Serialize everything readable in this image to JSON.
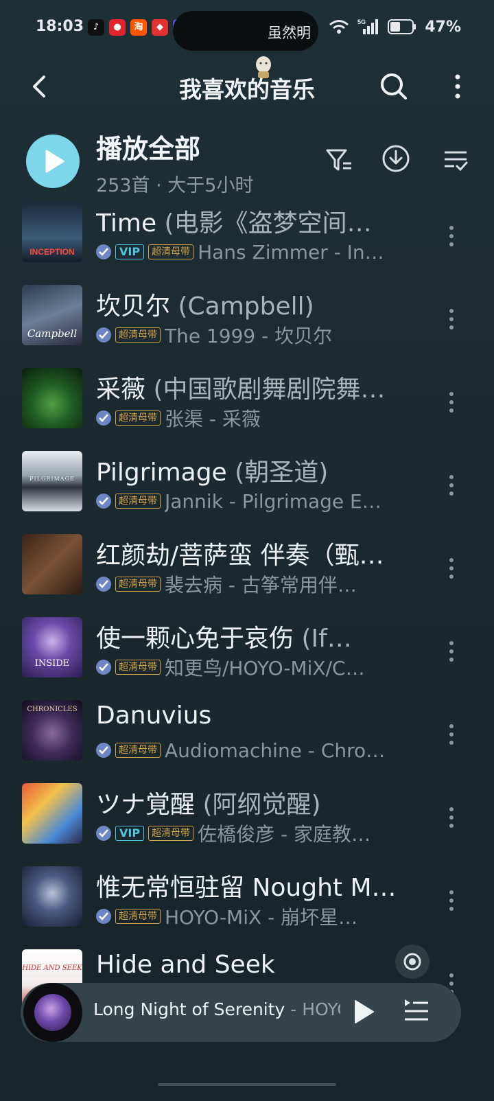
{
  "status_bar": {
    "time": "18:03",
    "pill_text": "虽然明",
    "battery": "47%",
    "network": "5G"
  },
  "header": {
    "title": "我喜欢的音乐"
  },
  "play_all": {
    "label": "播放全部",
    "meta": "253首 · 大于5小时"
  },
  "songs": [
    {
      "title": "Time",
      "subtitle": " (电影《盗梦空间…",
      "vip": true,
      "quality": "超清母带",
      "artist": "Hans Zimmer - In…",
      "cover_text": "INCEPTION"
    },
    {
      "title": "坎贝尔",
      "subtitle": " (Campbell)",
      "vip": false,
      "quality": "超清母带",
      "artist": "The 1999 - 坎贝尔",
      "cover_text": "Campbell"
    },
    {
      "title": "采薇",
      "subtitle": " (中国歌剧舞剧院舞…",
      "vip": false,
      "quality": "超清母带",
      "artist": "张渠 - 采薇",
      "cover_text": ""
    },
    {
      "title": "Pilgrimage",
      "subtitle": " (朝圣道)",
      "vip": false,
      "quality": "超清母带",
      "artist": "Jannik - Pilgrimage E…",
      "cover_text": "PILGRIMAGE"
    },
    {
      "title": "红颜劫/菩萨蛮 伴奏（甄…",
      "subtitle": "",
      "vip": false,
      "quality": "超清母带",
      "artist": "裴去病 - 古筝常用伴…",
      "cover_text": ""
    },
    {
      "title": "使一颗心免于哀伤",
      "subtitle": " (If…",
      "vip": false,
      "quality": "超清母带",
      "artist": "知更鸟/HOYO-MiX/C…",
      "cover_text": "INSIDE"
    },
    {
      "title": "Danuvius",
      "subtitle": "",
      "vip": false,
      "quality": "超清母带",
      "artist": "Audiomachine - Chro…",
      "cover_text": "CHRONICLES"
    },
    {
      "title": "ツナ覚醒",
      "subtitle": " (阿纲觉醒)",
      "vip": true,
      "quality": "超清母带",
      "artist": "佐橋俊彦 - 家庭教…",
      "cover_text": ""
    },
    {
      "title": "惟无常恒驻留 Nought M…",
      "subtitle": "",
      "vip": false,
      "quality": "超清母带",
      "artist": "HOYO-MiX - 崩坏星…",
      "cover_text": ""
    },
    {
      "title": "Hide and Seek",
      "subtitle": "",
      "vip": false,
      "quality": "",
      "artist": "",
      "cover_text": "HIDE AND SEEK"
    }
  ],
  "vip_label": "VIP",
  "mini_player": {
    "title": "Long Night of Serenity",
    "artist": " - HOYO-MiX"
  },
  "colors": {
    "accent": "#7dd6ea",
    "vip": "#4fc5e0",
    "quality": "#d6a34b",
    "check": "#6f86c4"
  }
}
